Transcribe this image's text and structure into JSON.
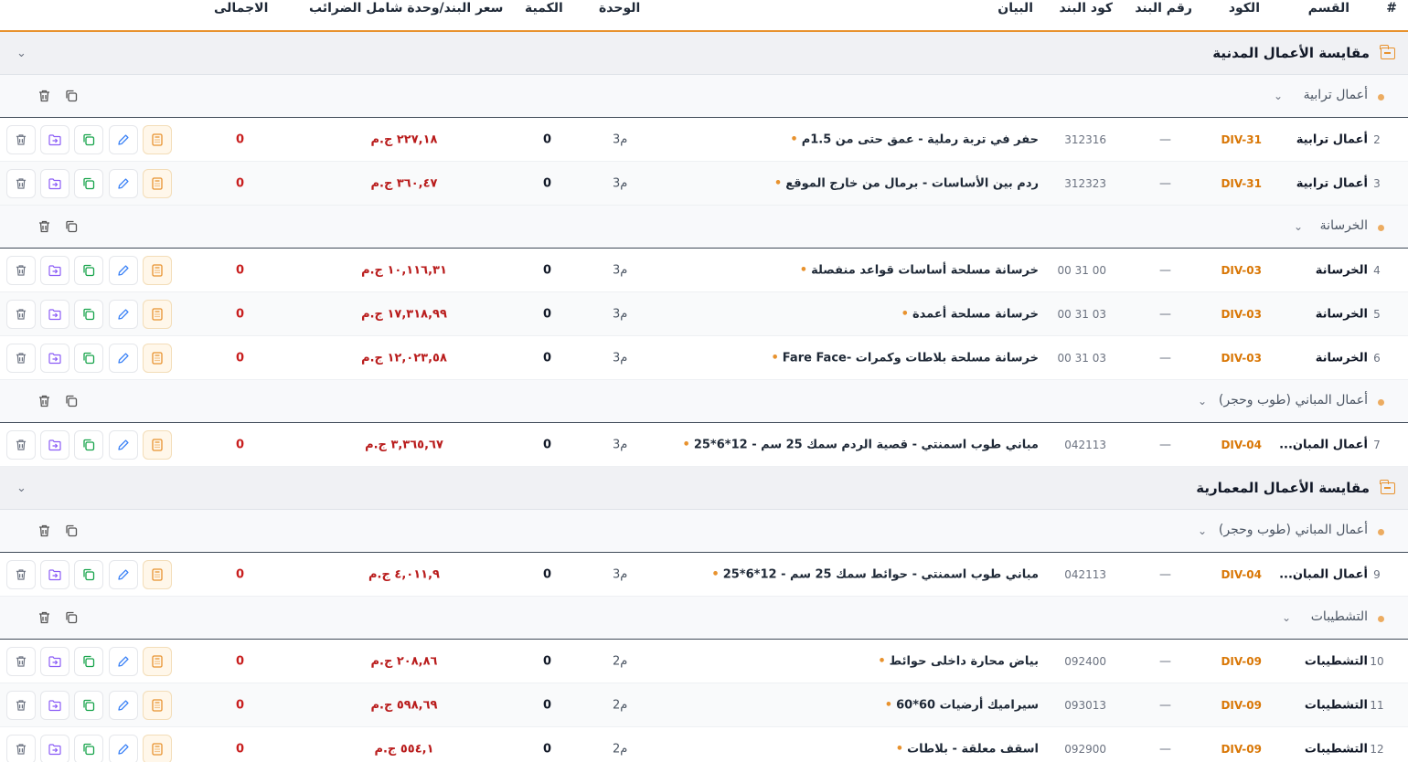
{
  "header": {
    "index": "#",
    "division": "القسم",
    "code": "الكود",
    "item_no": "رقم البند",
    "item_code": "كود البند",
    "description": "البيان",
    "unit": "الوحدة",
    "quantity": "الكمية",
    "unit_price": "سعر البند/وحدة شامل الضرائب",
    "total": "الاجمالى"
  },
  "sections": [
    {
      "title": "مقايسة الأعمال المدنية"
    },
    {
      "title": "مقايسة الأعمال المعمارية"
    }
  ],
  "groups": [
    {
      "title": "أعمال ترابية"
    },
    {
      "title": "الخرسانة"
    },
    {
      "title": "أعمال المباني (طوب وحجر)"
    },
    {
      "title": "أعمال المباني (طوب وحجر)"
    },
    {
      "title": "التشطيبات"
    }
  ],
  "rows": [
    {
      "num": "2",
      "division": "أعمال ترابية",
      "code": "DIV-31",
      "item_no": "—",
      "item_code": "312316",
      "description": "حفر في تربة رملية - عمق حتى من 1.5م",
      "unit": "م3",
      "qty": "0",
      "price": "٢٢٧,١٨ ج.م",
      "total": "0"
    },
    {
      "num": "3",
      "division": "أعمال ترابية",
      "code": "DIV-31",
      "item_no": "—",
      "item_code": "312323",
      "description": "ردم بين الأساسات - برمال من خارج الموقع",
      "unit": "م3",
      "qty": "0",
      "price": "٣٦٠,٤٧ ج.م",
      "total": "0"
    },
    {
      "num": "4",
      "division": "الخرسانة",
      "code": "DIV-03",
      "item_no": "—",
      "item_code": "00 31 00",
      "description": "خرسانة مسلحة أساسات قواعد منفصلة",
      "unit": "م3",
      "qty": "0",
      "price": "١٠,١١٦,٣١ ج.م",
      "total": "0"
    },
    {
      "num": "5",
      "division": "الخرسانة",
      "code": "DIV-03",
      "item_no": "—",
      "item_code": "03 31 00",
      "description": "خرسانة مسلحة أعمدة",
      "unit": "م3",
      "qty": "0",
      "price": "١٧,٣١٨,٩٩ ج.م",
      "total": "0"
    },
    {
      "num": "6",
      "division": "الخرسانة",
      "code": "DIV-03",
      "item_no": "—",
      "item_code": "03 31 00",
      "description": "خرسانة مسلحة بلاطات وكمرات -Fare Face",
      "unit": "م3",
      "qty": "0",
      "price": "١٢,٠٢٣,٥٨ ج.م",
      "total": "0"
    },
    {
      "num": "7",
      "division": "أعمال المبان...",
      "code": "DIV-04",
      "item_no": "—",
      "item_code": "042113",
      "description": "مباني طوب اسمنتي - قصية الردم سمك 25 سم - 12*6*25",
      "unit": "م3",
      "qty": "0",
      "price": "٣,٣٦٥,٦٧ ج.م",
      "total": "0"
    },
    {
      "num": "9",
      "division": "أعمال المبان...",
      "code": "DIV-04",
      "item_no": "—",
      "item_code": "042113",
      "description": "مباني طوب اسمنتي - حوائط سمك 25 سم - 12*6*25",
      "unit": "م3",
      "qty": "0",
      "price": "٤,٠١١,٩ ج.م",
      "total": "0"
    },
    {
      "num": "10",
      "division": "التشطيبات",
      "code": "DIV-09",
      "item_no": "—",
      "item_code": "092400",
      "description": "بياض محارة داخلى حوائط",
      "unit": "م2",
      "qty": "0",
      "price": "٢٠٨,٨٦ ج.م",
      "total": "0"
    },
    {
      "num": "11",
      "division": "التشطيبات",
      "code": "DIV-09",
      "item_no": "—",
      "item_code": "093013",
      "description": "سيراميك أرضيات 60*60",
      "unit": "م2",
      "qty": "0",
      "price": "٥٩٨,٦٩ ج.م",
      "total": "0"
    },
    {
      "num": "12",
      "division": "التشطيبات",
      "code": "DIV-09",
      "item_no": "—",
      "item_code": "092900",
      "description": "اسقف معلقة - بلاطات",
      "unit": "م2",
      "qty": "0",
      "price": "٥٥٤,١ ج.م",
      "total": "0"
    }
  ],
  "colors": {
    "accent": "#e8922e",
    "price": "#b91c1c",
    "code": "#d97706",
    "edit": "#3b82f6",
    "move": "#8b5cf6",
    "copy": "#16a34a"
  },
  "icons": {
    "section": "folder-icon",
    "collapse": "chevron-down-icon",
    "actions": [
      "calculator-icon",
      "edit-icon",
      "copy-icon",
      "move-icon",
      "trash-icon"
    ]
  }
}
